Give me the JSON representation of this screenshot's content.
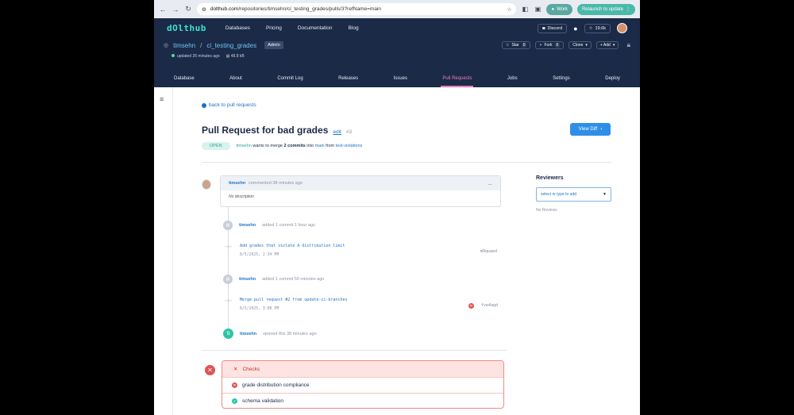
{
  "browser": {
    "url_domain": "dolthub.com",
    "url_path": "/repositories/timsehn/ci_testing_grades/pulls/3?refName=main",
    "work_chip": "Work",
    "relaunch_chip": "Relaunch to update"
  },
  "topnav": {
    "logo": "dOlthub",
    "links": [
      "Databases",
      "Pricing",
      "Documentation",
      "Blog"
    ],
    "discord": "Discord",
    "github_stars": "19.6k"
  },
  "repo": {
    "owner": "timsehn",
    "separator": "/",
    "name": "ci_testing_grades",
    "admin_badge": "Admin",
    "updated": "updated 26 minutes ago",
    "size": "48.8 kB",
    "star_label": "Star",
    "star_count": "0",
    "fork_label": "Fork",
    "fork_count": "0",
    "clone_label": "Clone",
    "add_label": "+ Add"
  },
  "tabs": [
    {
      "label": "Database",
      "active": false
    },
    {
      "label": "About",
      "active": false
    },
    {
      "label": "Commit Log",
      "active": false
    },
    {
      "label": "Releases",
      "active": false
    },
    {
      "label": "Issues",
      "active": false
    },
    {
      "label": "Pull Requests",
      "active": true
    },
    {
      "label": "Jobs",
      "active": false
    },
    {
      "label": "Settings",
      "active": false
    },
    {
      "label": "Deploy",
      "active": false
    }
  ],
  "pr": {
    "back_link": "back to pull requests",
    "title": "Pull Request for bad grades",
    "edit_label": "edit",
    "number": "#3",
    "view_diff": "View Diff",
    "status_badge": "OPEN",
    "author": "timsehn",
    "merge_text_1": "wants to merge",
    "merge_count": "2 commits",
    "merge_text_2": "into",
    "target_branch": "main",
    "merge_text_3": "from",
    "source_branch": "test-violations"
  },
  "comment": {
    "author": "timsehn",
    "action": "commented 38 minutes ago",
    "menu": "...",
    "body": "No description"
  },
  "timeline": {
    "event1": {
      "author": "timsehn",
      "text": "added 1 commit 1 hour ago"
    },
    "commit1": {
      "message": "Add grades that violate A distribution limit",
      "date": "8/5/2025, 2:34 PM",
      "hash": "m9quaed"
    },
    "event2": {
      "author": "timsehn",
      "text": "added 1 commit 50 minutes ago"
    },
    "commit2": {
      "message": "Merge pull request #2 from update-ci-branches",
      "date": "8/5/2025, 3:08 PM",
      "hash": "fve4agd"
    },
    "opened": {
      "author": "timsehn",
      "text": "opened this 38 minutes ago"
    }
  },
  "checks": {
    "title": "Checks",
    "items": [
      {
        "label": "grade distribution compliance",
        "status": "fail"
      },
      {
        "label": "schema validation",
        "status": "pass"
      }
    ]
  },
  "reviewers": {
    "title": "Reviewers",
    "placeholder": "select or type to add",
    "empty": "No Reviews"
  },
  "colors": {
    "header_bg": "#1b2a47",
    "accent_pink": "#f07cb5",
    "link_blue": "#1e72c4",
    "teal": "#2aa796",
    "fail_red": "#e05252",
    "pass_green": "#2dc4a5"
  }
}
